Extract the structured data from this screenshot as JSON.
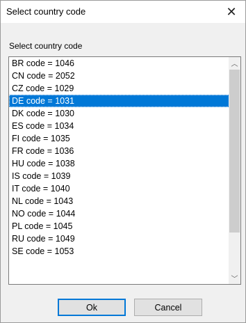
{
  "window": {
    "title": "Select country code"
  },
  "group": {
    "label": "Select country code"
  },
  "list": {
    "selected_index": 3,
    "items": [
      "BR code = 1046",
      "CN code = 2052",
      "CZ code = 1029",
      "DE code = 1031",
      "DK code = 1030",
      "ES code = 1034",
      "FI code = 1035",
      "FR code = 1036",
      "HU code = 1038",
      "IS code = 1039",
      "IT code = 1040",
      "NL code = 1043",
      "NO code = 1044",
      "PL code = 1045",
      "RU code = 1049",
      "SE code = 1053"
    ]
  },
  "icons": {
    "close": "close-icon",
    "scroll_up": "chevron-up-icon",
    "scroll_down": "chevron-down-icon"
  },
  "colors": {
    "selection": "#0078d7",
    "default_button_border": "#0078d7"
  },
  "buttons": {
    "ok": "Ok",
    "cancel": "Cancel"
  }
}
